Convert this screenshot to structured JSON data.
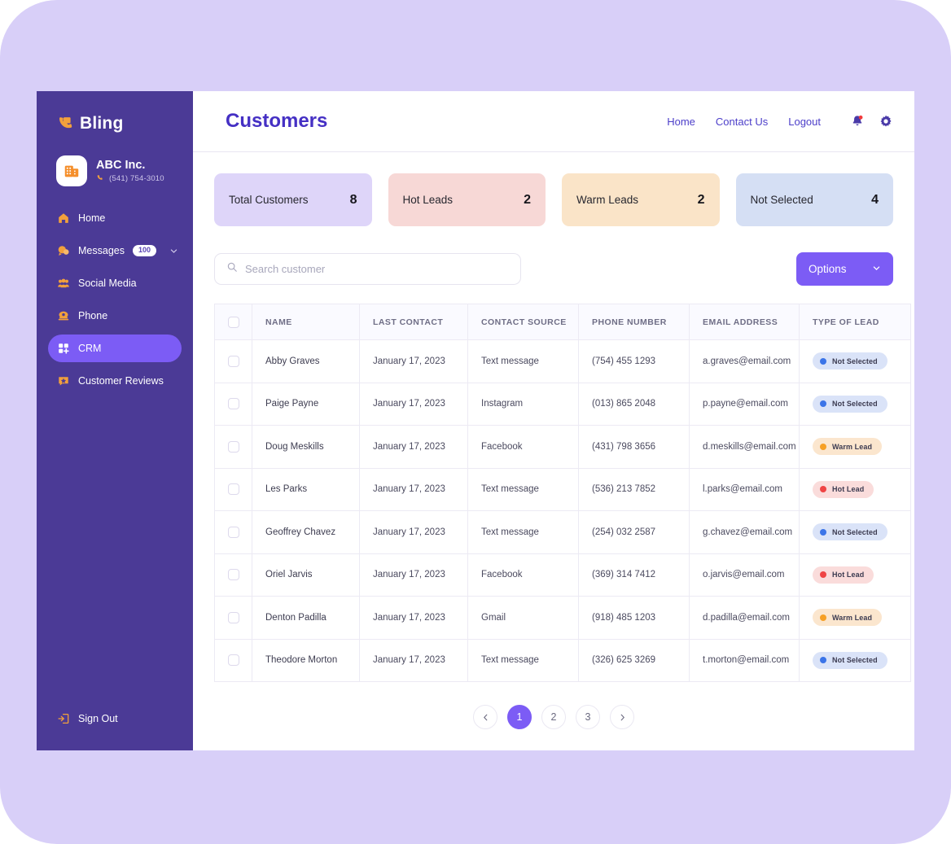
{
  "brand": {
    "name": "Bling",
    "logo_icon": "phone-handset-icon"
  },
  "org": {
    "name": "ABC Inc.",
    "phone": "(541) 754-3010",
    "avatar_icon": "office-building-icon",
    "phone_icon": "phone-icon"
  },
  "sidebar": {
    "items": [
      {
        "label": "Home",
        "icon": "home-icon",
        "active": false
      },
      {
        "label": "Messages",
        "icon": "chat-bubbles-icon",
        "active": false,
        "badge": "100",
        "chevron": "chevron-down-icon"
      },
      {
        "label": "Social Media",
        "icon": "people-group-icon",
        "active": false
      },
      {
        "label": "Phone",
        "icon": "telephone-icon",
        "active": false
      },
      {
        "label": "CRM",
        "icon": "grid-plus-icon",
        "active": true
      },
      {
        "label": "Customer Reviews",
        "icon": "review-star-icon",
        "active": false
      }
    ],
    "sign_out": {
      "label": "Sign Out",
      "icon": "sign-out-icon"
    }
  },
  "header": {
    "title": "Customers",
    "nav": [
      "Home",
      "Contact Us",
      "Logout"
    ],
    "icons": [
      "notification-bell-icon",
      "gear-icon"
    ],
    "has_notification_dot": true
  },
  "stats": [
    {
      "label": "Total Customers",
      "value": "8",
      "bg": "#ded5f9"
    },
    {
      "label": "Hot Leads",
      "value": "2",
      "bg": "#f7d8d6"
    },
    {
      "label": "Warm Leads",
      "value": "2",
      "bg": "#fae4c8"
    },
    {
      "label": "Not Selected",
      "value": "4",
      "bg": "#d5dff4"
    }
  ],
  "toolbar": {
    "search_placeholder": "Search customer",
    "search_value": "",
    "search_icon": "search-icon",
    "options_label": "Options",
    "options_chevron": "chevron-down-icon"
  },
  "table": {
    "columns": [
      "NAME",
      "LAST CONTACT",
      "CONTACT SOURCE",
      "PHONE NUMBER",
      "EMAIL ADDRESS",
      "TYPE OF LEAD"
    ],
    "rows": [
      {
        "name": "Abby Graves",
        "last_contact": "January 17, 2023",
        "source": "Text message",
        "phone": "(754) 455 1293",
        "email": "a.graves@email.com",
        "lead": "Not Selected",
        "lead_type": "not-selected"
      },
      {
        "name": "Paige Payne",
        "last_contact": "January 17, 2023",
        "source": "Instagram",
        "phone": "(013) 865 2048",
        "email": "p.payne@email.com",
        "lead": "Not Selected",
        "lead_type": "not-selected"
      },
      {
        "name": "Doug Meskills",
        "last_contact": "January 17, 2023",
        "source": "Facebook",
        "phone": "(431) 798 3656",
        "email": "d.meskills@email.com",
        "lead": "Warm Lead",
        "lead_type": "warm"
      },
      {
        "name": "Les Parks",
        "last_contact": "January 17, 2023",
        "source": "Text message",
        "phone": "(536) 213 7852",
        "email": "l.parks@email.com",
        "lead": "Hot Lead",
        "lead_type": "hot"
      },
      {
        "name": "Geoffrey Chavez",
        "last_contact": "January 17, 2023",
        "source": "Text message",
        "phone": "(254) 032 2587",
        "email": "g.chavez@email.com",
        "lead": "Not Selected",
        "lead_type": "not-selected"
      },
      {
        "name": "Oriel Jarvis",
        "last_contact": "January 17, 2023",
        "source": "Facebook",
        "phone": "(369) 314 7412",
        "email": "o.jarvis@email.com",
        "lead": "Hot Lead",
        "lead_type": "hot"
      },
      {
        "name": "Denton Padilla",
        "last_contact": "January 17, 2023",
        "source": "Gmail",
        "phone": "(918) 485 1203",
        "email": "d.padilla@email.com",
        "lead": "Warm Lead",
        "lead_type": "warm"
      },
      {
        "name": "Theodore Morton",
        "last_contact": "January 17, 2023",
        "source": "Text message",
        "phone": "(326) 625 3269",
        "email": "t.morton@email.com",
        "lead": "Not Selected",
        "lead_type": "not-selected"
      }
    ]
  },
  "lead_styles": {
    "not-selected": {
      "bg": "#dae3f8",
      "dot": "#3b74e8",
      "fg": "#3b3a50"
    },
    "warm": {
      "bg": "#fbe6ce",
      "dot": "#f6a025",
      "fg": "#3b3a50"
    },
    "hot": {
      "bg": "#fadcdb",
      "dot": "#ef4444",
      "fg": "#3b3a50"
    }
  },
  "pagination": {
    "prev_icon": "chevron-left-icon",
    "next_icon": "chevron-right-icon",
    "pages": [
      "1",
      "2",
      "3"
    ],
    "current": "1"
  },
  "colors": {
    "canvas": "#d8cff8",
    "sidebar": "#4b3a96",
    "accent": "#7c5cf5",
    "title": "#4530c4",
    "brand_orange": "#f2a03c"
  }
}
